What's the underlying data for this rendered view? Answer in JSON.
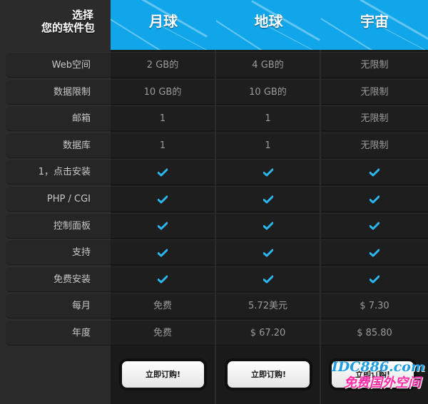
{
  "header": {
    "label_line1": "选择",
    "label_line2": "您的软件包",
    "plans": [
      "月球",
      "地球",
      "宇宙"
    ]
  },
  "rows": [
    {
      "label": "Web空间",
      "values": [
        "2 GB的",
        "4 GB的",
        "无限制"
      ]
    },
    {
      "label": "数据限制",
      "values": [
        "10 GB的",
        "10 GB的",
        "无限制"
      ]
    },
    {
      "label": "邮箱",
      "values": [
        "1",
        "1",
        "无限制"
      ]
    },
    {
      "label": "数据库",
      "values": [
        "1",
        "1",
        "无限制"
      ]
    },
    {
      "label": "1，点击安装",
      "values": [
        "check",
        "check",
        "check"
      ]
    },
    {
      "label": "PHP / CGI",
      "values": [
        "check",
        "check",
        "check"
      ]
    },
    {
      "label": "控制面板",
      "values": [
        "check",
        "check",
        "check"
      ]
    },
    {
      "label": "支持",
      "values": [
        "check",
        "check",
        "check"
      ]
    },
    {
      "label": "免费安装",
      "values": [
        "check",
        "check",
        "check"
      ]
    },
    {
      "label": "每月",
      "values": [
        "免费",
        "5.72美元",
        "$ 7.30"
      ]
    },
    {
      "label": "年度",
      "values": [
        "免费",
        "$ 67.20",
        "$ 85.80"
      ]
    }
  ],
  "buttons": {
    "order_label": "立即订购!"
  },
  "watermark": {
    "line1": "IDC886.com",
    "line2": "免费国外空间"
  },
  "colors": {
    "accent": "#11a6ea",
    "check": "#2bb8f0",
    "background": "#2b2b2b"
  }
}
